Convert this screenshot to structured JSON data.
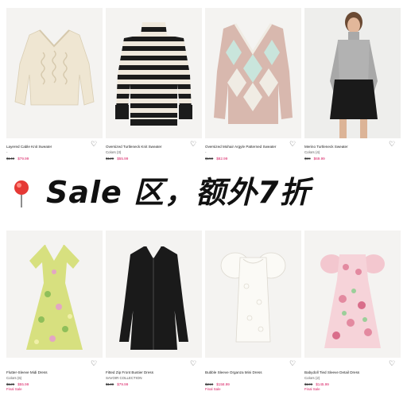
{
  "banner": {
    "text": "Sale 区，额外7折"
  },
  "products_top": [
    {
      "name": "Layered Cable Knit Sweater",
      "sub": "-",
      "old": "$149",
      "new": "$79.99",
      "tag": ""
    },
    {
      "name": "Oversized Turtleneck Knit Sweater",
      "sub": "Colors (3)",
      "old": "$129",
      "new": "$55.99",
      "tag": ""
    },
    {
      "name": "Oversized Mohair Argyle Patterned Sweater",
      "sub": "-",
      "old": "$159",
      "new": "$82.99",
      "tag": ""
    },
    {
      "name": "Merino Turtleneck Sweater",
      "sub": "Colors (4)",
      "old": "$99",
      "new": "$69.99",
      "tag": ""
    }
  ],
  "products_bottom": [
    {
      "name": "Flutter-Sleeve Midi Dress",
      "sub": "Colors (6)",
      "old": "$129",
      "new": "$55.99",
      "tag": "Final Sale"
    },
    {
      "name": "Fitted Zip Front Bustier Dress",
      "sub": "SAVOIR COLLECTION",
      "old": "$149",
      "new": "$79.99",
      "tag": ""
    },
    {
      "name": "Bubble Sleeve Organza Mini Dress",
      "sub": "",
      "old": "$219",
      "new": "$158.99",
      "tag": "Final Sale"
    },
    {
      "name": "Babydoll Tied Sleeve Detail Dress",
      "sub": "Colors (2)",
      "old": "$199",
      "new": "$145.99",
      "tag": "Final Sale"
    }
  ],
  "icons": {
    "favorite": "heart-outline-icon",
    "pin": "red-pushpin-icon"
  },
  "colors": {
    "sale_price": "#d81b60",
    "accent_pin": "#e53935"
  }
}
